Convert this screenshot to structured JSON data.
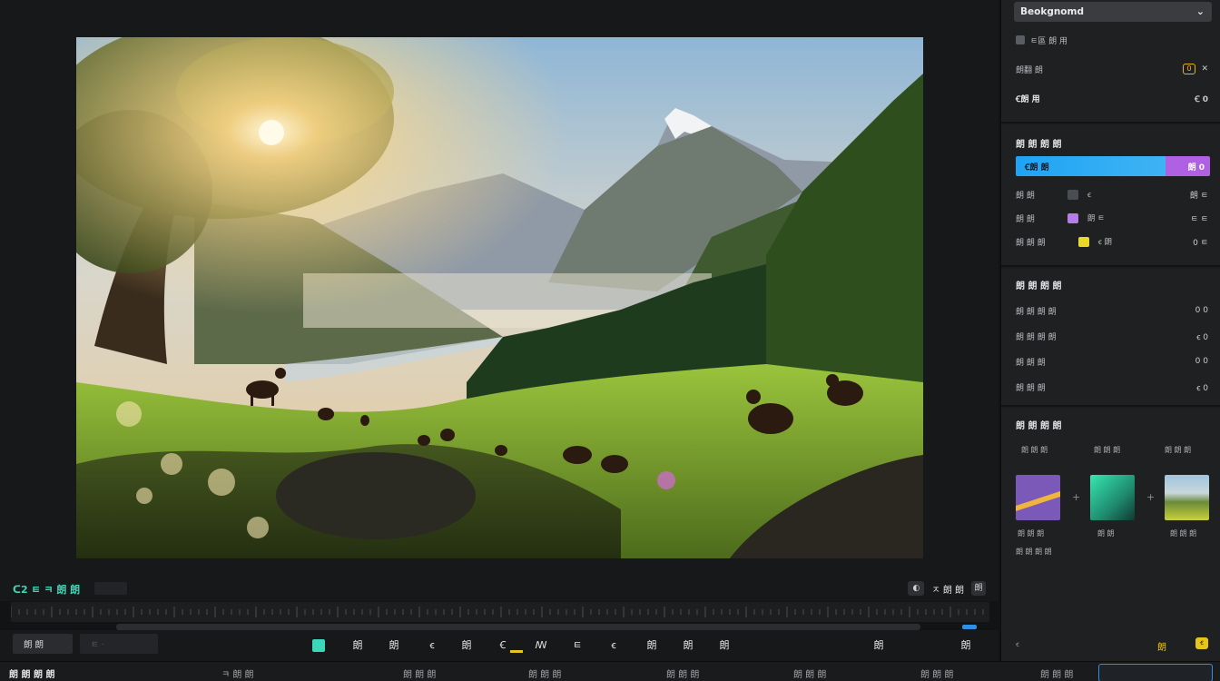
{
  "inspector": {
    "background_dropdown": "Beokgnomd",
    "background_rows": [
      {
        "label": "ㅌ區 朗 用",
        "value": ""
      },
      {
        "label": "朗翻 朗",
        "value": "0"
      },
      {
        "label": "Ꞓ朗 用",
        "value": "Ꞓ 0"
      }
    ],
    "gradient_title": "朗 朗 朗 朗",
    "gradient_bar": {
      "left_label": "Ꞓ朗 朗",
      "right_label": "朗 0"
    },
    "gradient_stops": [
      {
        "label": "朗 朗",
        "mid": "ꞓ",
        "value": "朗 ㅌ",
        "color": "#4a4d52"
      },
      {
        "label": "朗 朗",
        "mid": "朗 ㅌ",
        "value": "ㅌ ㅌ",
        "color": "#b87ce8"
      },
      {
        "label": "朗 朗 朗",
        "mid": "ꞓ 朗",
        "value": "0 ㅌ",
        "color": "#e8d82a"
      }
    ],
    "adjust_title": "朗 朗 朗 朗",
    "adjust_rows": [
      {
        "label": "朗 朗 朗 朗",
        "value": "0 0"
      },
      {
        "label": "朗 朗 朗 朗",
        "value": "ꞓ 0"
      },
      {
        "label": "朗 朗 朗",
        "value": "0 0"
      },
      {
        "label": "朗 朗 朗",
        "value": "ꞓ 0"
      }
    ],
    "effects_title": "朗 朗 朗 朗",
    "effects_headers": [
      "朗 朗 朗",
      "朗 朗 朗",
      "朗 朗 朗"
    ],
    "effects_captions": [
      "朗 朗 朗",
      "朗 朗",
      "朗 朗 朗"
    ],
    "effects_footer": "朗 朗 朗 朗",
    "bottom_icons": [
      "ꞓ",
      "朗",
      "ꞓ"
    ]
  },
  "timeline": {
    "name": "ᑕ2 ㅌ ㅋ 朗 朗",
    "right_label": "ㅈ 朗 朗",
    "right_extra": "朗"
  },
  "toolbar": {
    "left_field": "朗 朗",
    "tools": [
      "朗",
      "朗",
      "ꞓ",
      "朗",
      "Ꞓ",
      "ꟿ",
      "ㅌ",
      "ꞓ",
      "朗",
      "朗",
      "朗",
      "朗"
    ],
    "right_icon": "朗"
  },
  "tabs": [
    "朗 朗 朗 朗",
    "ㅋ 朗 朗",
    "朗 朗 朗",
    "朗 朗 朗",
    "朗 朗 朗",
    "朗 朗 朗",
    "朗 朗 朗",
    "朗 朗 朗"
  ],
  "colors": {
    "accent_teal": "#3ad8b8",
    "accent_blue": "#1ea4f5",
    "accent_purple": "#b061e3",
    "accent_yellow": "#e6b31a"
  }
}
